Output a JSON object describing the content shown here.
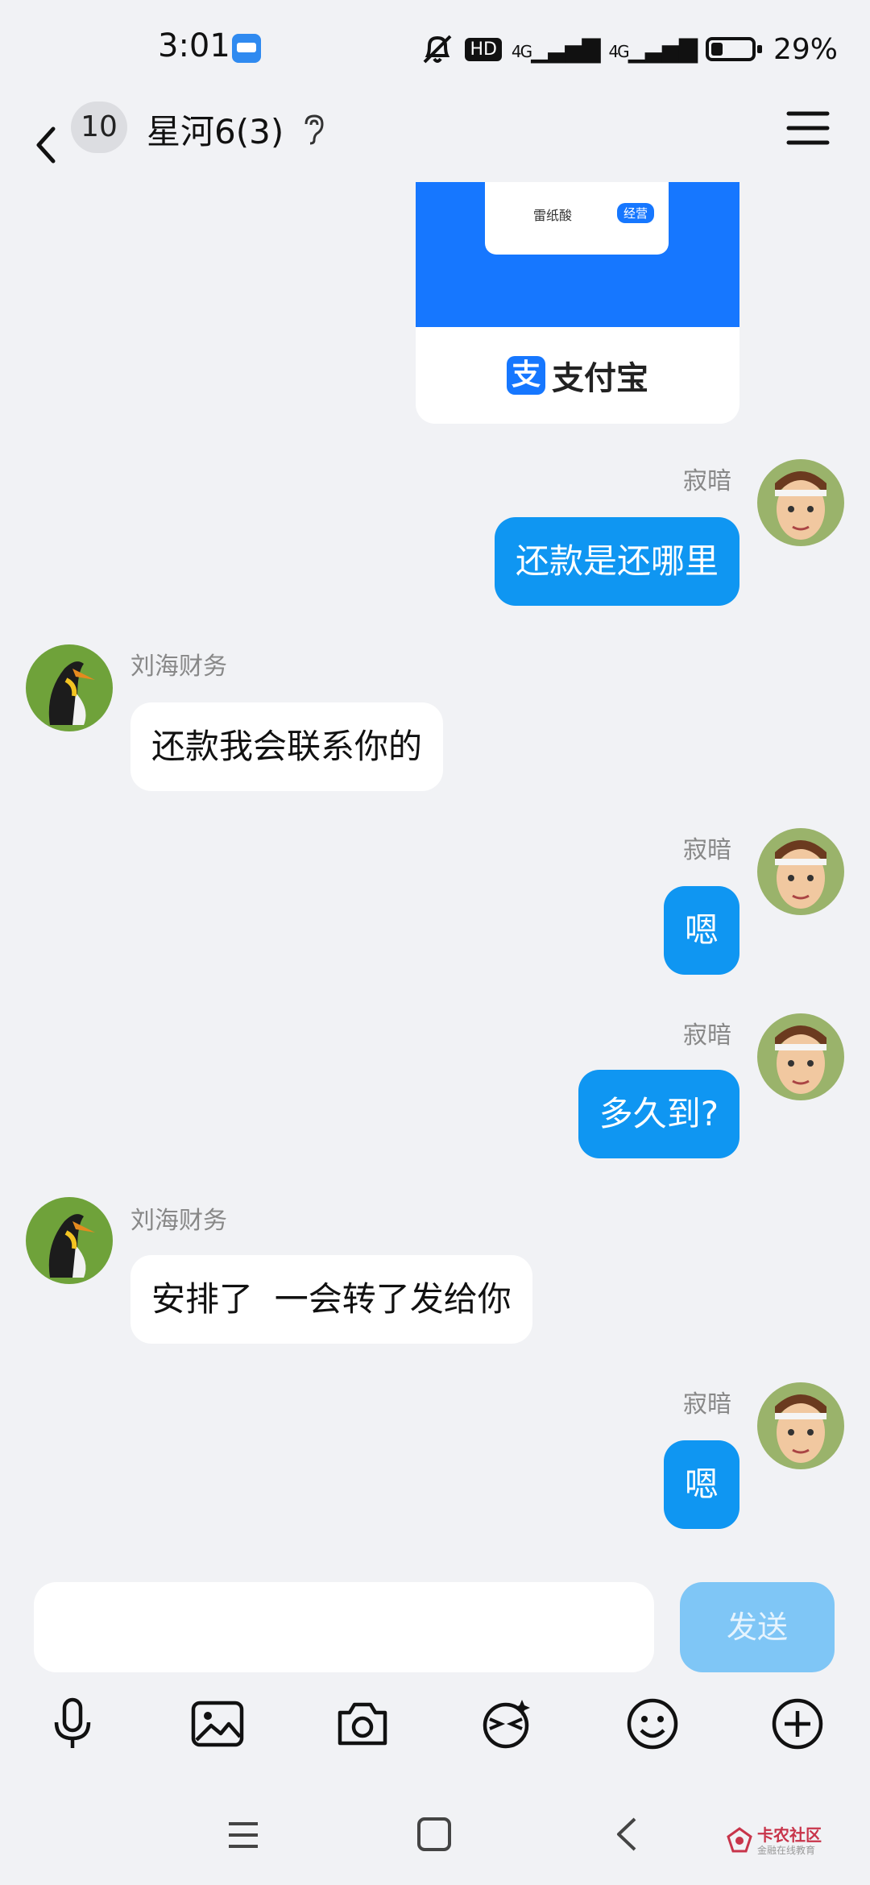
{
  "status": {
    "time": "3:01",
    "network_1": "4G",
    "network_2": "4G",
    "battery": "29%",
    "battery_level": 0.29,
    "hd": "HD"
  },
  "header": {
    "unread_count": "10",
    "title": "星河6(3)"
  },
  "payment_card": {
    "merchant": "雷纸酸",
    "tag": "经营",
    "brand": "支付宝",
    "logo": "支"
  },
  "messages": [
    {
      "side": "out",
      "sender": "寂暗",
      "text": "还款是还哪里"
    },
    {
      "side": "in",
      "sender": "刘海财务",
      "text": "还款我会联系你的"
    },
    {
      "side": "out",
      "sender": "寂暗",
      "text": "嗯"
    },
    {
      "side": "out",
      "sender": "寂暗",
      "text": "多久到?"
    },
    {
      "side": "in",
      "sender": "刘海财务",
      "text": "安排了  一会转了发给你"
    },
    {
      "side": "out",
      "sender": "寂暗",
      "text": "嗯"
    }
  ],
  "composer": {
    "input_value": "",
    "send_label": "发送"
  },
  "toolbar": [
    "microphone-icon",
    "image-icon",
    "camera-icon",
    "sticker-icon",
    "emoji-icon",
    "plus-icon"
  ],
  "watermark": {
    "title": "卡农社区",
    "subtitle": "金融在线教育"
  },
  "colors": {
    "bubble_out": "#0f96f2",
    "bubble_in": "#ffffff",
    "background": "#f1f2f5",
    "send_disabled": "#7fc6f6",
    "alipay_blue": "#1677ff"
  }
}
